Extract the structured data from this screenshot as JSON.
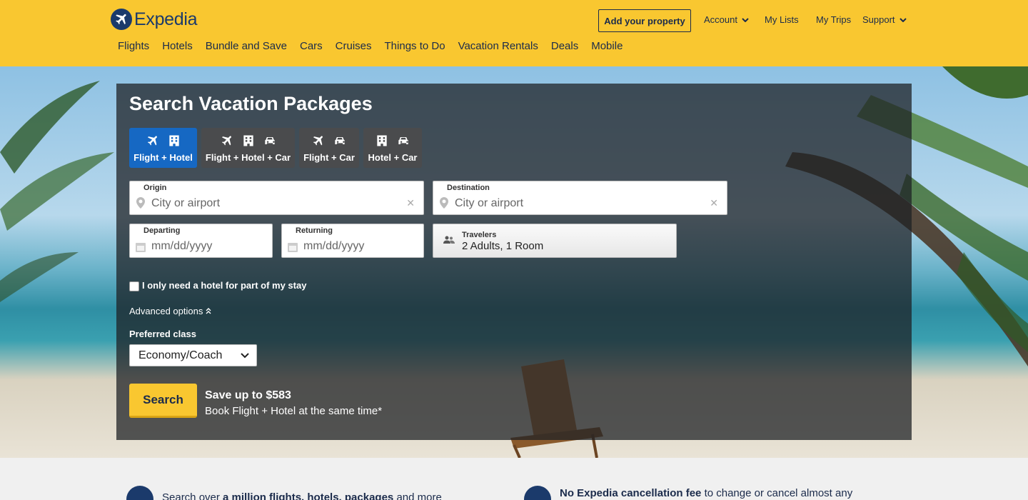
{
  "header": {
    "logo_text": "Expedia",
    "add_property": "Add your property",
    "account": "Account",
    "my_lists": "My Lists",
    "my_trips": "My Trips",
    "support": "Support",
    "nav": [
      "Flights",
      "Hotels",
      "Bundle and Save",
      "Cars",
      "Cruises",
      "Things to Do",
      "Vacation Rentals",
      "Deals",
      "Mobile"
    ]
  },
  "search": {
    "title": "Search Vacation Packages",
    "tabs": [
      {
        "label": "Flight + Hotel",
        "icons": [
          "plane-icon",
          "hotel-icon"
        ],
        "active": true
      },
      {
        "label": "Flight + Hotel + Car",
        "icons": [
          "plane-icon",
          "hotel-icon",
          "car-icon"
        ],
        "active": false
      },
      {
        "label": "Flight + Car",
        "icons": [
          "plane-icon",
          "car-icon"
        ],
        "active": false
      },
      {
        "label": "Hotel + Car",
        "icons": [
          "hotel-icon",
          "car-icon"
        ],
        "active": false
      }
    ],
    "origin": {
      "label": "Origin",
      "placeholder": "City or airport"
    },
    "destination": {
      "label": "Destination",
      "placeholder": "City or airport"
    },
    "departing": {
      "label": "Departing",
      "placeholder": "mm/dd/yyyy"
    },
    "returning": {
      "label": "Returning",
      "placeholder": "mm/dd/yyyy"
    },
    "travelers": {
      "label": "Travelers",
      "value": "2 Adults, 1 Room"
    },
    "partial_stay_label": "I only need a hotel for part of my stay",
    "advanced_options": "Advanced options",
    "preferred_class_label": "Preferred class",
    "preferred_class_value": "Economy/Coach",
    "search_button": "Search",
    "save_title": "Save up to $583",
    "save_subtitle": "Book Flight + Hotel at the same time*"
  },
  "benefits": [
    {
      "lead": "Search over ",
      "bold": "a million flights, hotels, packages",
      "tail": " and more"
    },
    {
      "lead": "",
      "bold": "No Expedia cancellation fee",
      "tail": " to change or cancel almost any"
    }
  ],
  "colors": {
    "header": "#f9c730",
    "active_tab": "#1668c3",
    "brand_navy": "#1b3a6b"
  }
}
